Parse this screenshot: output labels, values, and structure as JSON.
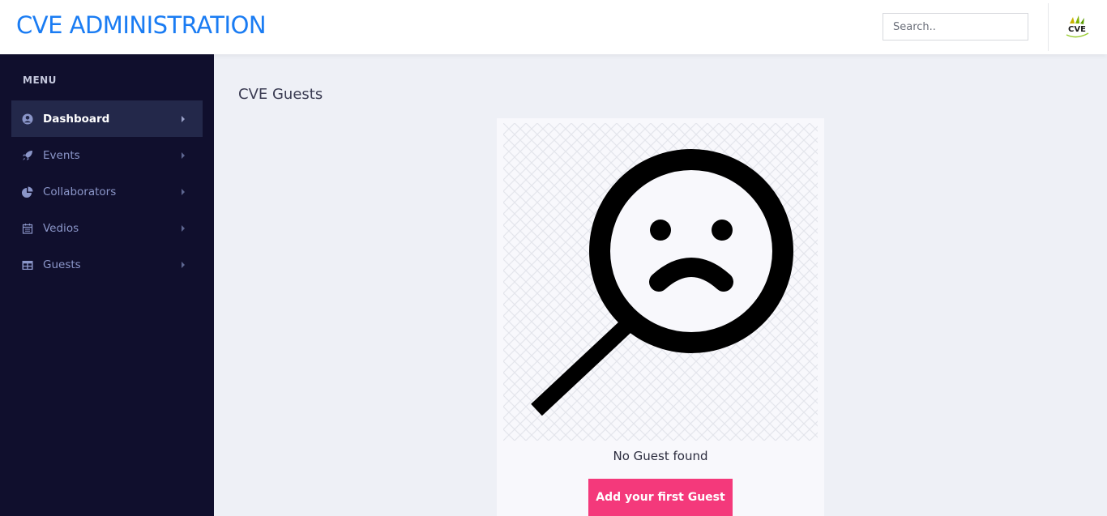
{
  "header": {
    "brand": "CVE ADMINISTRATION",
    "search_placeholder": "Search..",
    "logo_text": "CVE",
    "brand_color": "#1a7cf3"
  },
  "sidebar": {
    "menu_title": "MENU",
    "background": "#100f2d",
    "items": [
      {
        "label": "Dashboard",
        "icon": "user-circle-icon",
        "active": true
      },
      {
        "label": "Events",
        "icon": "rocket-icon",
        "active": false
      },
      {
        "label": "Collaborators",
        "icon": "pie-chart-icon",
        "active": false
      },
      {
        "label": "Vedios",
        "icon": "calendar-icon",
        "active": false
      },
      {
        "label": "Guests",
        "icon": "table-icon",
        "active": false
      }
    ]
  },
  "main": {
    "page_title": "CVE Guests",
    "empty_state": {
      "illustration": "sad-face-magnifier-icon",
      "message": "No Guest found",
      "button_label": "Add your first Guest",
      "button_color": "#f4397b"
    }
  }
}
